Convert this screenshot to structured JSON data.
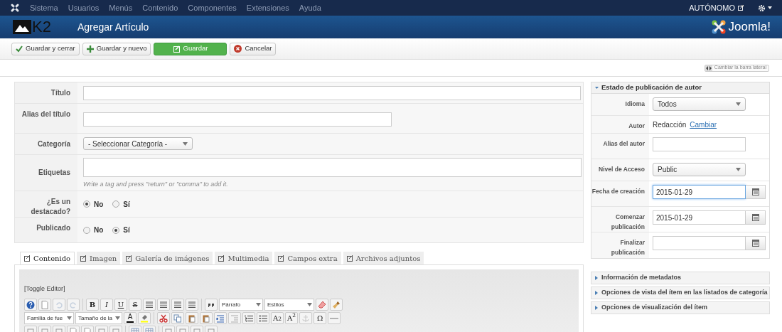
{
  "top_menu": {
    "items": [
      "Sistema",
      "Usuarios",
      "Menús",
      "Contenido",
      "Componentes",
      "Extensiones",
      "Ayuda"
    ],
    "site": "AUTÓNOMO"
  },
  "header": {
    "logo_text": "K2",
    "title": "Agregar Artículo",
    "brand": "Joomla!"
  },
  "toolbar": [
    {
      "kind": "save_close",
      "label": "Guardar y cerrar"
    },
    {
      "kind": "save_new",
      "label": "Guardar y nuevo"
    },
    {
      "kind": "save",
      "label": "Guardar"
    },
    {
      "kind": "cancel",
      "label": "Cancelar"
    }
  ],
  "sidebar_toggle": "Cambiar la barra lateral",
  "form": {
    "rows": [
      {
        "kind": "text",
        "label": "Título"
      },
      {
        "kind": "text_short",
        "label": "Alias del título"
      },
      {
        "kind": "select",
        "label": "Categoría",
        "value": "- Seleccionar Categoría -"
      },
      {
        "kind": "tags",
        "label": "Etiquetas",
        "hint": "Write a tag and press \"return\" or \"comma\" to add it."
      },
      {
        "kind": "radio",
        "label": "¿Es un destacado?",
        "options": [
          {
            "label": "No",
            "selected": true
          },
          {
            "label": "Sí",
            "selected": false
          }
        ]
      },
      {
        "kind": "radio",
        "label": "Publicado",
        "options": [
          {
            "label": "No",
            "selected": false
          },
          {
            "label": "Sí",
            "selected": true
          }
        ]
      }
    ]
  },
  "tabs": [
    {
      "label": "Contenido",
      "selected": true
    },
    {
      "label": "Imagen",
      "selected": false
    },
    {
      "label": "Galería de imágenes",
      "selected": false
    },
    {
      "label": "Multimedia",
      "selected": false
    },
    {
      "label": "Campos extra",
      "selected": false
    },
    {
      "label": "Archivos adjuntos",
      "selected": false
    }
  ],
  "editor": {
    "toggle": "[Toggle Editor]",
    "labels": [
      "B",
      "I",
      "U",
      "S",
      "A",
      "A$_{2}$",
      "A$^{2}$",
      "Ω"
    ],
    "selects": [
      "Párrafo",
      "Estilos",
      "Familia de fue",
      "Tamaño de la"
    ]
  },
  "side_panel": {
    "title": "Estado de publicación de autor",
    "expanded": true,
    "rows": [
      {
        "kind": "select",
        "label": "Idioma",
        "value": "Todos"
      },
      {
        "kind": "author",
        "label": "Autor",
        "value": "Redacción",
        "link": "Cambiar"
      },
      {
        "kind": "text",
        "label": "Alias del autor"
      },
      {
        "kind": "select",
        "label": "Nivel de Acceso",
        "value": "Public"
      },
      {
        "kind": "date",
        "label": "Fecha de creación",
        "value": "2015-01-29",
        "focused": true
      },
      {
        "kind": "date",
        "label": "Comenzar publicación",
        "value": "2015-01-29",
        "focused": false
      },
      {
        "kind": "date",
        "label": "Finalizar publicación",
        "focused": false
      }
    ]
  },
  "accordions": [
    {
      "title": "Información de metadatos",
      "expanded": false
    },
    {
      "title": "Opciones de vista del ítem en las listados de categoría",
      "expanded": false
    },
    {
      "title": "Opciones de visualización del ítem",
      "expanded": false
    }
  ]
}
